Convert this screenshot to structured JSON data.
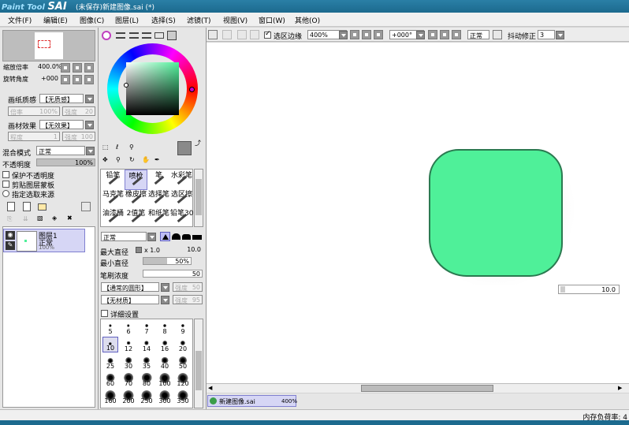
{
  "titlebar": {
    "logo_a": "Paint Tool",
    "logo_b": "SAI",
    "title": "(未保存)新建图像.sai (*)"
  },
  "menu": [
    "文件(F)",
    "编辑(E)",
    "图像(C)",
    "图层(L)",
    "选择(S)",
    "滤镜(T)",
    "视图(V)",
    "窗口(W)",
    "其他(O)"
  ],
  "navigator": {
    "zoom_label": "缩放倍率",
    "zoom_value": "400.0%",
    "angle_label": "旋转角度",
    "angle_value": "+000"
  },
  "paper": {
    "texture_label": "画纸质感",
    "texture_value": "【无质感】",
    "scale_label": "倍率",
    "scale_value": "100%",
    "strength_label": "强度",
    "strength_value": "20",
    "effect_label": "画材效果",
    "effect_value": "【无效果】",
    "degree_label": "程度",
    "degree_value": "1",
    "strength2_label": "强度",
    "strength2_value": "100"
  },
  "layer": {
    "blend_label": "混合模式",
    "blend_value": "正常",
    "opacity_label": "不透明度",
    "opacity_value": "100%",
    "protect_label": "保护不透明度",
    "clip_label": "剪贴图层蒙板",
    "source_label": "指定选取来源",
    "item_name": "图层1",
    "item_mode": "正常",
    "item_opacity": "100%"
  },
  "tools": [
    {
      "label": "铅笔"
    },
    {
      "label": "喷枪"
    },
    {
      "label": "笔"
    },
    {
      "label": "水彩笔"
    },
    {
      "label": "马克笔"
    },
    {
      "label": "橡皮擦"
    },
    {
      "label": "选择笔"
    },
    {
      "label": "选区擦"
    },
    {
      "label": "油漆桶"
    },
    {
      "label": "2值笔"
    },
    {
      "label": "和纸笔"
    },
    {
      "label": "铅笔30"
    }
  ],
  "brush": {
    "mode": "正常",
    "max_label": "最大直径",
    "max_mult": "x 1.0",
    "max_value": "10.0",
    "min_label": "最小直径",
    "min_value": "50%",
    "min_fraction": 0.5,
    "density_label": "笔刷浓度",
    "density_value": "50",
    "density_fraction": 1.0,
    "shape_value": "【通常的圆形】",
    "shape_str_label": "强度",
    "shape_str_value": "50",
    "tex_value": "【无材质】",
    "tex_str_label": "强度",
    "tex_str_value": "95",
    "detail_label": "详细设置"
  },
  "sizes": [
    "5",
    "6",
    "7",
    "8",
    "9",
    "10",
    "12",
    "14",
    "16",
    "20",
    "25",
    "30",
    "35",
    "40",
    "50",
    "60",
    "70",
    "80",
    "100",
    "120",
    "160",
    "200",
    "250",
    "300",
    "350"
  ],
  "toolbar": {
    "selection_edge": "选区边缘",
    "zoom": "400%",
    "angle": "+000°",
    "mode": "正常",
    "stab_label": "抖动修正",
    "stab_value": "3"
  },
  "canvas": {
    "shape_color": "#4ff099",
    "size_readout": "10.0"
  },
  "tab": {
    "name": "新建图像.sai",
    "zoom": "400%"
  },
  "status": {
    "memory": "内存负荷率: 4"
  },
  "colors": {
    "primary": "#8a8a8a"
  }
}
